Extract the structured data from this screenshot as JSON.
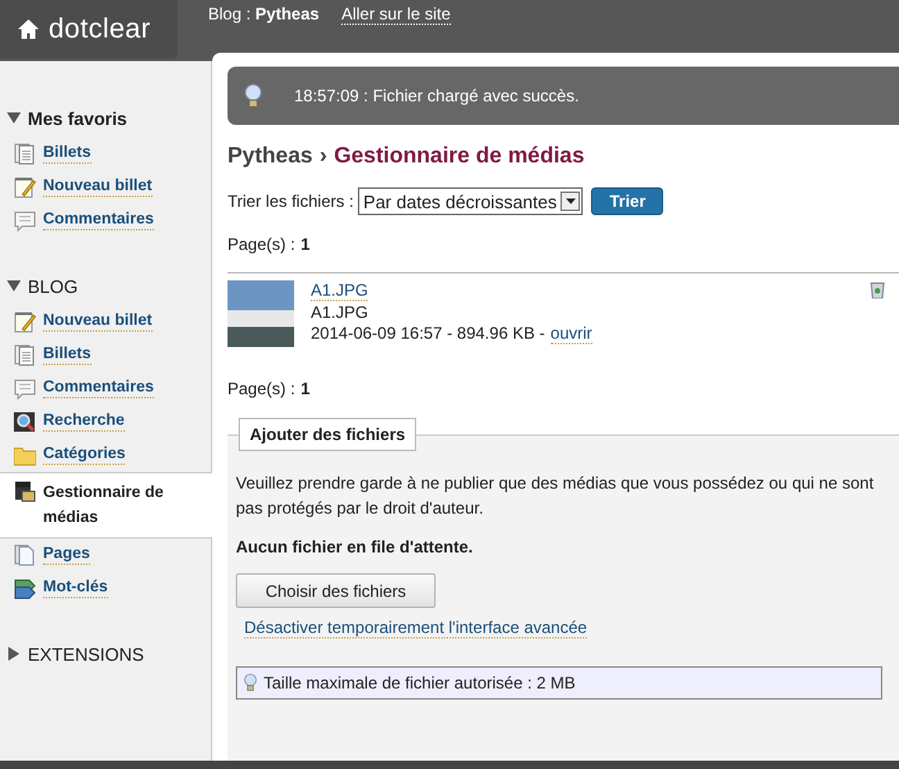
{
  "header": {
    "logo": "dotclear",
    "blog_label": "Blog :",
    "blog_name": "Pytheas",
    "site_link": "Aller sur le site"
  },
  "sidebar": {
    "sections": [
      {
        "title": "Mes favoris",
        "expanded": true,
        "items": [
          {
            "label": "Billets",
            "kind": "posts",
            "selected": false
          },
          {
            "label": "Nouveau billet",
            "kind": "edit",
            "selected": false
          },
          {
            "label": "Commentaires",
            "kind": "comments",
            "selected": false
          }
        ]
      },
      {
        "title": "BLOG",
        "expanded": true,
        "items": [
          {
            "label": "Nouveau billet",
            "kind": "edit",
            "selected": false
          },
          {
            "label": "Billets",
            "kind": "posts",
            "selected": false
          },
          {
            "label": "Commentaires",
            "kind": "comments",
            "selected": false
          },
          {
            "label": "Recherche",
            "kind": "search",
            "selected": false
          },
          {
            "label": "Catégories",
            "kind": "folder",
            "selected": false
          },
          {
            "label": "Gestionnaire de médias",
            "kind": "media",
            "selected": true
          },
          {
            "label": "Pages",
            "kind": "page",
            "selected": false
          },
          {
            "label": "Mot-clés",
            "kind": "tags",
            "selected": false
          }
        ]
      },
      {
        "title": "EXTENSIONS",
        "expanded": false
      }
    ]
  },
  "notice": "18:57:09 : Fichier chargé avec succès.",
  "title": {
    "blog": "Pytheas",
    "separator": "›",
    "page": "Gestionnaire de médias"
  },
  "sort": {
    "label": "Trier les fichiers :",
    "value": "Par dates décroissantes",
    "button": "Trier"
  },
  "pages_top": {
    "label": "Page(s) :",
    "value": "1"
  },
  "files": [
    {
      "link": "A1.JPG",
      "name": "A1.JPG",
      "info": "2014-06-09 16:57 - 894.96 KB -",
      "open": "ouvrir"
    }
  ],
  "pages_bottom": {
    "label": "Page(s) :",
    "value": "1"
  },
  "upload": {
    "legend": "Ajouter des fichiers",
    "warning": "Veuillez prendre garde à ne publier que des médias que vous possédez ou qui ne sont pas protégés par le droit d'auteur.",
    "queue": "Aucun fichier en file d'attente.",
    "choose": "Choisir des fichiers",
    "disable_link": "Désactiver temporairement l'interface avancée",
    "max_size": "Taille maximale de fichier autorisée : 2 MB"
  }
}
